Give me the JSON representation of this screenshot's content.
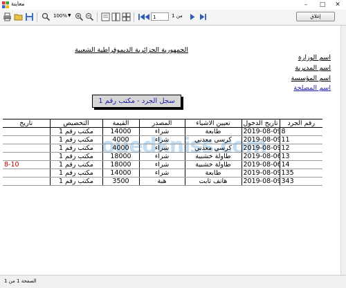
{
  "window": {
    "title": "معاينة"
  },
  "toolbar": {
    "zoom": "100%",
    "page_input": "1",
    "page_of": "من 1",
    "close_label": "إغلاق"
  },
  "report": {
    "title": "الجمهورية الجزائرية الديموقراطية الشعبية",
    "org_lines": [
      "اسم الوزارة",
      "اسم المديرية",
      "اسم المؤسسة",
      "اسم المصلحة"
    ],
    "register_title": "سجل الجرد - مكتب رقم 1",
    "columns": [
      "رقم الجرد",
      "تاريخ الدخول",
      "تعيين الاشياء",
      "المصدر",
      "القيمة",
      "التخصيص",
      "تاريخ"
    ],
    "rows": [
      {
        "num": "8",
        "date": "2019-08-09",
        "desc": "طابعة",
        "source": "شراء",
        "value": "14000",
        "alloc": "مكتب رقم 1",
        "extra": ""
      },
      {
        "num": "11",
        "date": "2019-08-09",
        "desc": "كرسي معدني",
        "source": "شراء",
        "value": "4000",
        "alloc": "مكتب رقم 1",
        "extra": ""
      },
      {
        "num": "12",
        "date": "2019-08-09",
        "desc": "كرسي معدني",
        "source": "شراء",
        "value": "4000",
        "alloc": "مكتب رقم 1",
        "extra": ""
      },
      {
        "num": "13",
        "date": "2019-08-06",
        "desc": "طاولة خشبية",
        "source": "شراء",
        "value": "18000",
        "alloc": "مكتب رقم 1",
        "extra": ""
      },
      {
        "num": "14",
        "date": "2019-08-06",
        "desc": "طاولة خشبية",
        "source": "شراء",
        "value": "18000",
        "alloc": "مكتب رقم 1",
        "extra": "8-10"
      },
      {
        "num": "135",
        "date": "2019-08-09",
        "desc": "طابعة",
        "source": "شراء",
        "value": "14000",
        "alloc": "مكتب رقم 1",
        "extra": ""
      },
      {
        "num": "343",
        "date": "2019-08-09",
        "desc": "هاتف ثابت",
        "source": "هبة",
        "value": "3500",
        "alloc": "مكتب رقم 1",
        "extra": ""
      }
    ]
  },
  "watermark": "ouedkniss.com",
  "status": {
    "page_info": "الصفحة 1 من 1"
  },
  "icons": [
    "app-icon",
    "print-icon",
    "open-icon",
    "save-icon",
    "search-icon",
    "zoom-in-icon",
    "zoom-out-icon",
    "page-layout-icon",
    "first-page-icon",
    "prev-page-icon",
    "next-page-icon",
    "last-page-icon"
  ]
}
